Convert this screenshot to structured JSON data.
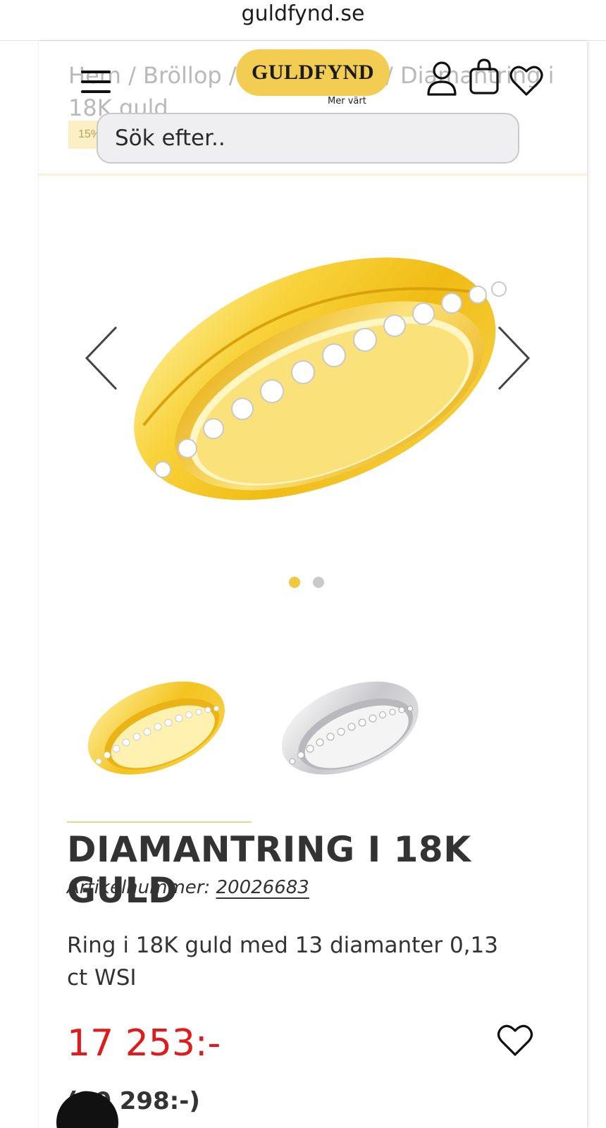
{
  "browser": {
    "url": "guldfynd.se"
  },
  "header": {
    "logo_text": "GULDFYND",
    "logo_tagline": "Mer värt",
    "search_placeholder": "Sök efter..",
    "icons": [
      "menu-icon",
      "user-icon",
      "shopping-bag-icon",
      "heart-icon"
    ]
  },
  "breadcrumb": {
    "text": "Hem / Bröllop / Vigselringar / Diamantring i 18K guld",
    "badge": "15%"
  },
  "gallery": {
    "active_index": 0,
    "count": 2,
    "thumbnails": [
      "gold",
      "white-gold"
    ]
  },
  "product": {
    "title": "DIAMANTRING I 18K GULD",
    "article_label": "Artikelnummer:",
    "article_number": "20026683",
    "description": "Ring i 18K guld med 13 diamanter 0,13 ct WSI",
    "price": "17 253:-",
    "old_price": "(20 298:-)"
  },
  "colors": {
    "brand_yellow": "#f3cd52",
    "price_red": "#e01b1b",
    "dot_active": "#f1c93f",
    "dot_inactive": "#c9c9c9"
  }
}
